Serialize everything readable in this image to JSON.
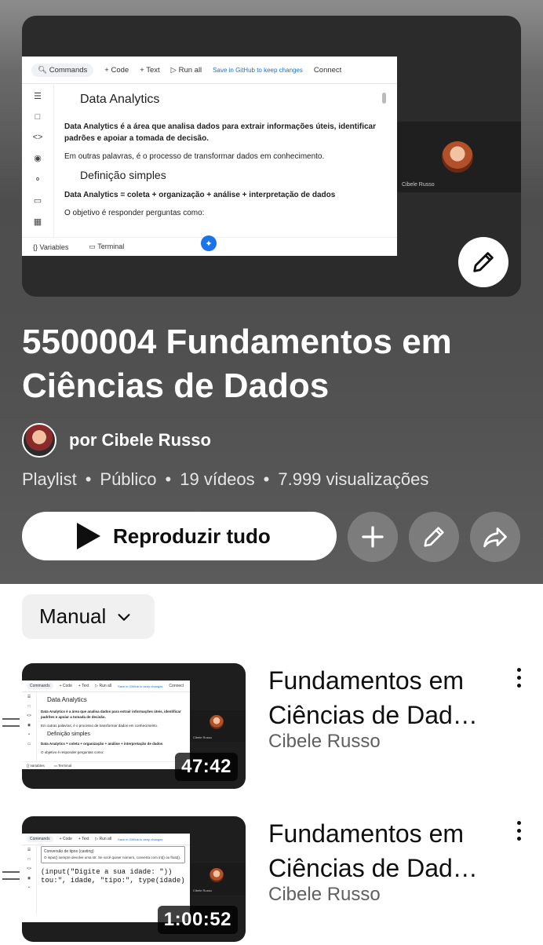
{
  "hero": {
    "colab": {
      "toolbar": [
        "Commands",
        "Code",
        "Text",
        "Run all",
        "Save in GitHub to keep changes",
        "Connect"
      ],
      "heading": "Data Analytics",
      "p1": "Data Analytics é a área que analisa dados para extrair informações úteis, identificar padrões e apoiar a tomada de decisão.",
      "p2": "Em outras palavras, é o processo de transformar dados em conhecimento.",
      "subheading": "Definição simples",
      "p3": "Data Analytics = coleta + organização + análise + interpretação de dados",
      "p4": "O objetivo é responder perguntas como:",
      "bottom_variables": "Variables",
      "bottom_terminal": "Terminal"
    },
    "participant_name": "Cibele Russo"
  },
  "playlist": {
    "title": "5500004 Fundamentos em Ciências de Dados",
    "author": "por Cibele Russo",
    "meta": [
      "Playlist",
      "Público",
      "19 vídeos",
      "7.999 visualizações"
    ],
    "play_all_label": "Reproduzir tudo"
  },
  "sort": {
    "label": "Manual"
  },
  "videos": [
    {
      "title": "Fundamentos em Ciências de Dad…",
      "channel": "Cibele Russo",
      "duration": "47:42",
      "thumb": {
        "heading": "Data Analytics",
        "p1": "Data Analytics é a área que analisa dados para extrair informações úteis, identificar padrões e apoiar a tomada de decisão.",
        "p2": "Em outras palavras, é o processo de transformar dados em conhecimento.",
        "subheading": "Definição simples",
        "p3": "Data Analytics = coleta + organização + análise + interpretação de dados",
        "p4": "O objetivo é responder perguntas como:",
        "participant": "Cibele Russo"
      }
    },
    {
      "title": "Fundamentos em Ciências de Dad…",
      "channel": "Cibele Russo",
      "duration": "1:00:52",
      "thumb": {
        "cell_title": "Conversão de tipos (casting)",
        "cell_text": "O input() sempre devolve uma str. Se você quiser número, converta com int() ou float().",
        "code_line1": "(input(\"Digite a sua idade: \"))",
        "code_line2": "tou:\", idade, \"tipo:\", type(idade)",
        "participant": "Cibele Russo"
      }
    }
  ],
  "colors": {
    "header_background": "#5a5a5a",
    "text_primary": "#0f0f0f",
    "text_secondary": "#606060",
    "colab_blue": "#1a73e8"
  },
  "icons": [
    "pencil-icon",
    "play-icon",
    "plus-icon",
    "share-arrow-icon",
    "chevron-down-icon",
    "more-vert-icon",
    "drag-handle-icon"
  ]
}
